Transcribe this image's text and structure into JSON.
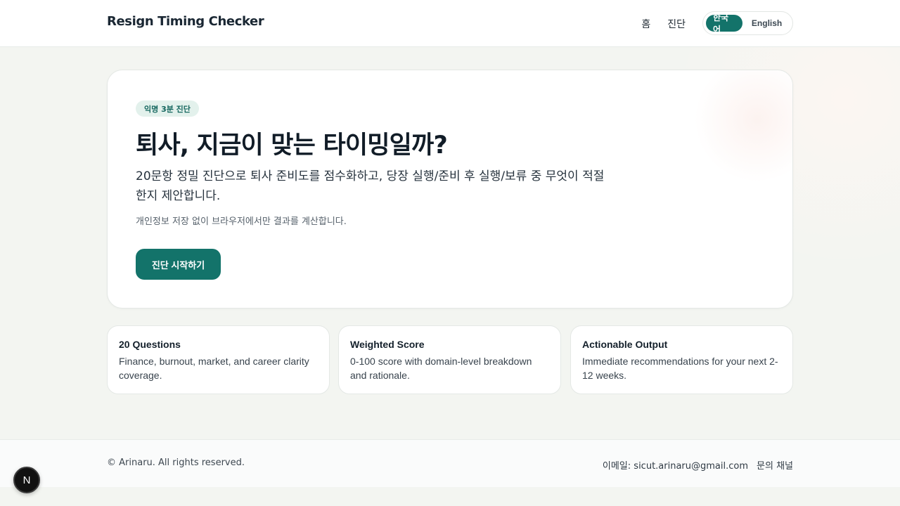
{
  "header": {
    "brand": "Resign Timing Checker",
    "nav": [
      {
        "label": "홈"
      },
      {
        "label": "진단"
      }
    ],
    "language": {
      "options": [
        "한국어",
        "English"
      ],
      "selected": "한국어"
    }
  },
  "hero": {
    "badge": "익명 3분 진단",
    "title": "퇴사, 지금이 맞는 타이밍일까?",
    "subtitle": "20문항 정밀 진단으로 퇴사 준비도를 점수화하고, 당장 실행/준비 후 실행/보류 중 무엇이 적절한지 제안합니다.",
    "note": "개인정보 저장 없이 브라우저에서만 결과를 계산합니다.",
    "cta_label": "진단 시작하기"
  },
  "features": [
    {
      "title": "20 Questions",
      "desc": "Finance, burnout, market, and career clarity coverage."
    },
    {
      "title": "Weighted Score",
      "desc": "0-100 score with domain-level breakdown and rationale."
    },
    {
      "title": "Actionable Output",
      "desc": "Immediate recommendations for your next 2-12 weeks."
    }
  ],
  "footer": {
    "copyright": "© Arinaru. All rights reserved.",
    "email": "이메일: sicut.arinaru@gmail.com",
    "contact": "문의 채널"
  },
  "fab": {
    "label": "N",
    "icon": "nextjs-logo-icon"
  },
  "colors": {
    "accent": "#13736a",
    "badge_bg": "#e3f1ec"
  }
}
